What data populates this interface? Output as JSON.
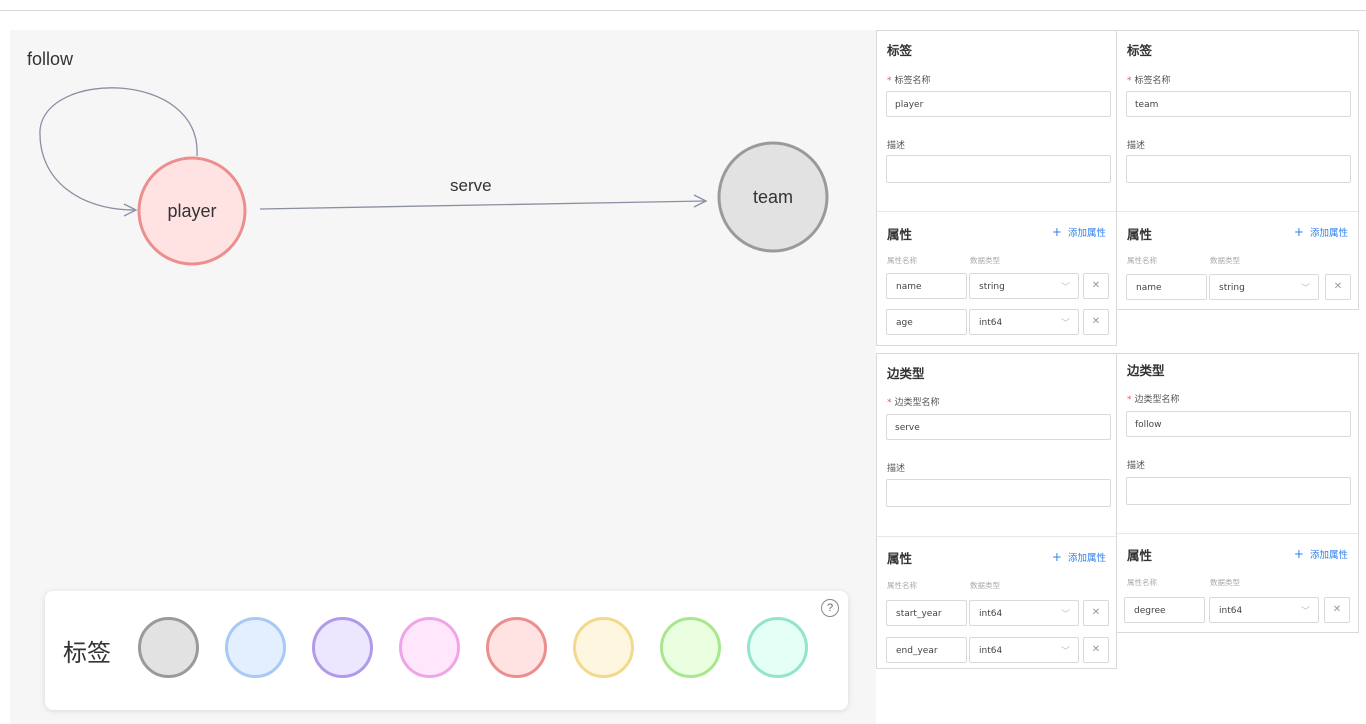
{
  "graph": {
    "nodes": [
      {
        "id": "player",
        "label": "player"
      },
      {
        "id": "team",
        "label": "team"
      }
    ],
    "edges": [
      {
        "label": "follow"
      },
      {
        "label": "serve"
      }
    ]
  },
  "palette": {
    "title": "标签",
    "help_glyph": "?",
    "colors": [
      {
        "fill": "#e2e2e2",
        "stroke": "#9a9a9a"
      },
      {
        "fill": "#e3efff",
        "stroke": "#a8c8f5"
      },
      {
        "fill": "#ece6ff",
        "stroke": "#b29ae8"
      },
      {
        "fill": "#ffe6fb",
        "stroke": "#f0a6e6"
      },
      {
        "fill": "#ffe3e3",
        "stroke": "#ec8e8e"
      },
      {
        "fill": "#fff6df",
        "stroke": "#f2d98f"
      },
      {
        "fill": "#eaffdf",
        "stroke": "#a9e690"
      },
      {
        "fill": "#e3fff6",
        "stroke": "#93e3cf"
      }
    ]
  },
  "tag_panels": [
    {
      "title": "标签",
      "name_label": "标签名称",
      "name_value": "player",
      "desc_label": "描述",
      "desc_value": "",
      "props_title": "属性",
      "add_label": "添加属性",
      "col_name": "属性名称",
      "col_type": "数据类型",
      "props": [
        {
          "name": "name",
          "type": "string"
        },
        {
          "name": "age",
          "type": "int64"
        }
      ]
    },
    {
      "title": "标签",
      "name_label": "标签名称",
      "name_value": "team",
      "desc_label": "描述",
      "desc_value": "",
      "props_title": "属性",
      "add_label": "添加属性",
      "col_name": "属性名称",
      "col_type": "数据类型",
      "props": [
        {
          "name": "name",
          "type": "string"
        }
      ]
    }
  ],
  "edge_panels": [
    {
      "title": "边类型",
      "name_label": "边类型名称",
      "name_value": "serve",
      "desc_label": "描述",
      "desc_value": "",
      "props_title": "属性",
      "add_label": "添加属性",
      "col_name": "属性名称",
      "col_type": "数据类型",
      "props": [
        {
          "name": "start_year",
          "type": "int64"
        },
        {
          "name": "end_year",
          "type": "int64"
        }
      ]
    },
    {
      "title": "边类型",
      "name_label": "边类型名称",
      "name_value": "follow",
      "desc_label": "描述",
      "desc_value": "",
      "props_title": "属性",
      "add_label": "添加属性",
      "col_name": "属性名称",
      "col_type": "数据类型",
      "props": [
        {
          "name": "degree",
          "type": "int64"
        }
      ]
    }
  ],
  "colors": {
    "player_fill": "#ffe3e3",
    "player_stroke": "#ec8e8e",
    "team_fill": "#e2e2e2",
    "team_stroke": "#9a9a9a",
    "edge": "#8a8fa3",
    "link": "#2f80ed"
  },
  "icons": {
    "add": "plus-icon",
    "remove": "close-icon",
    "dropdown": "chevron-down-icon",
    "help": "question-circle-icon"
  }
}
